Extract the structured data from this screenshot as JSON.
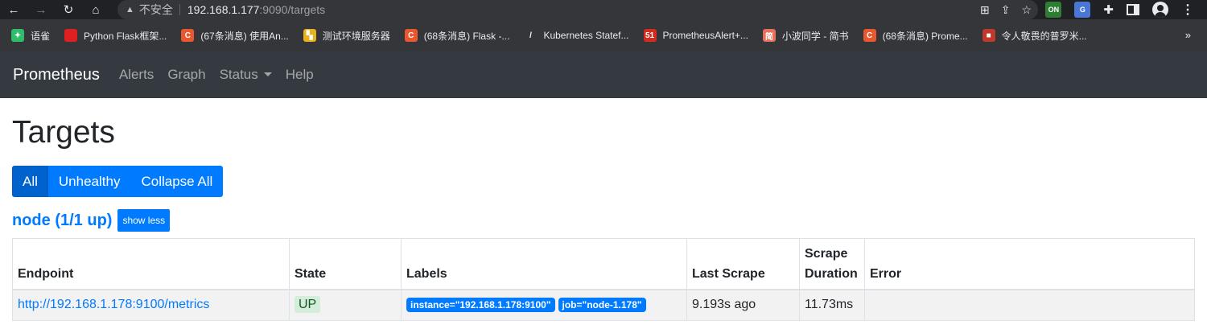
{
  "browser": {
    "omnibox": {
      "security_label": "不安全",
      "host": "192.168.1.177",
      "path": ":9090/targets"
    },
    "bookmarks": [
      {
        "label": "语雀",
        "icon": "yuque-icon",
        "color": "#2fbd6b",
        "glyph": "✦"
      },
      {
        "label": "Python Flask框架...",
        "icon": "redcube-icon",
        "color": "#e02020",
        "glyph": ""
      },
      {
        "label": "(67条消息) 使用An...",
        "icon": "csdn-icon",
        "color": "#e8572e",
        "glyph": "C"
      },
      {
        "label": "测试环境服务器",
        "icon": "pixel-icon",
        "color": "#e8b21c",
        "glyph": "▚"
      },
      {
        "label": "(68条消息) Flask -...",
        "icon": "csdn-icon",
        "color": "#e8572e",
        "glyph": "C"
      },
      {
        "label": "Kubernetes Statef...",
        "icon": "slash-icon",
        "color": "#35363a",
        "glyph": "/"
      },
      {
        "label": "PrometheusAlert+...",
        "icon": "51cto-icon",
        "color": "#d52b1e",
        "glyph": "51"
      },
      {
        "label": "小波同学 - 简书",
        "icon": "jianshu-icon",
        "color": "#ea6f5a",
        "glyph": "简"
      },
      {
        "label": "(68条消息) Prome...",
        "icon": "csdn-icon",
        "color": "#e8572e",
        "glyph": "C"
      },
      {
        "label": "令人敬畏的普罗米...",
        "icon": "smallred-icon",
        "color": "#c0392b",
        "glyph": "■"
      }
    ],
    "bookmarks_more": "»"
  },
  "navbar": {
    "brand": "Prometheus",
    "links": [
      "Alerts",
      "Graph",
      "Status",
      "Help"
    ]
  },
  "page": {
    "title": "Targets",
    "filters": {
      "all": "All",
      "unhealthy": "Unhealthy",
      "collapse": "Collapse All"
    },
    "group": {
      "title": "node (1/1 up)",
      "toggle": "show less"
    },
    "table": {
      "headers": [
        "Endpoint",
        "State",
        "Labels",
        "Last Scrape",
        "Scrape Duration",
        "Error"
      ],
      "rows": [
        {
          "endpoint": "http://192.168.1.178:9100/metrics",
          "state": "UP",
          "labels": [
            "instance=\"192.168.1.178:9100\"",
            "job=\"node-1.178\""
          ],
          "last_scrape": "9.193s ago",
          "duration": "11.73ms",
          "error": ""
        }
      ]
    }
  },
  "colors": {
    "navbar_bg": "#343a40",
    "primary": "#007bff",
    "up_badge_bg": "#d4edda",
    "up_badge_fg": "#155724"
  }
}
